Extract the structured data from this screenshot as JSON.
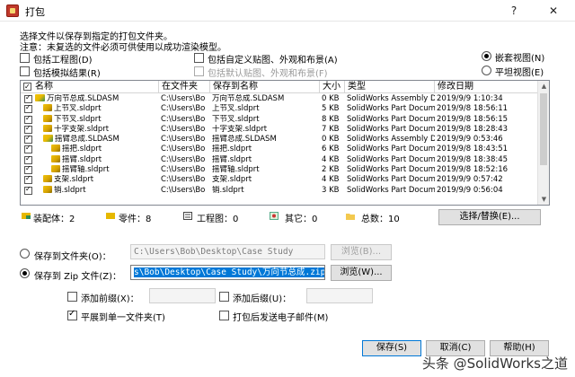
{
  "window": {
    "title": "打包",
    "help_glyph": "?",
    "close_glyph": "✕"
  },
  "hints": {
    "line1": "选择文件以保存到指定的打包文件夹。",
    "line2": "注意：未复选的文件必须可供使用以成功渲染模型。"
  },
  "options": {
    "include_drawings": "包括工程图(D)",
    "include_sim": "包括模拟结果(R)",
    "include_custom": "包括自定义贴图、外观和布景(A)",
    "include_default": "包括默认贴图、外观和布景(F)",
    "view_nested": "嵌套视图(N)",
    "view_flat": "平坦视图(E)"
  },
  "table": {
    "headers": [
      "名称",
      "在文件夹",
      "保存到名称",
      "大小",
      "类型",
      "修改日期"
    ],
    "rows": [
      {
        "name": "万向节总成.SLDASM",
        "folder": "C:\\Users\\Bo",
        "save_name": "万向节总成.SLDASM",
        "size": "0 KB",
        "type": "SolidWorks Assembly D",
        "date": "2019/9/9 1:10:34",
        "kind": "asm",
        "indent": 0
      },
      {
        "name": "上节叉.sldprt",
        "folder": "C:\\Users\\Bo",
        "save_name": "上节叉.sldprt",
        "size": "5 KB",
        "type": "SolidWorks Part Docum",
        "date": "2019/9/8 18:56:11",
        "kind": "part",
        "indent": 1
      },
      {
        "name": "下节叉.sldprt",
        "folder": "C:\\Users\\Bo",
        "save_name": "下节叉.sldprt",
        "size": "8 KB",
        "type": "SolidWorks Part Docum",
        "date": "2019/9/8 18:56:15",
        "kind": "part",
        "indent": 1
      },
      {
        "name": "十字支架.sldprt",
        "folder": "C:\\Users\\Bo",
        "save_name": "十字支架.sldprt",
        "size": "7 KB",
        "type": "SolidWorks Part Docum",
        "date": "2019/9/8 18:28:43",
        "kind": "part",
        "indent": 1
      },
      {
        "name": "摇臂总成.SLDASM",
        "folder": "C:\\Users\\Bo",
        "save_name": "摇臂总成.SLDASM",
        "size": "0 KB",
        "type": "SolidWorks Assembly D",
        "date": "2019/9/9 0:53:46",
        "kind": "asm",
        "indent": 1
      },
      {
        "name": "摇把.sldprt",
        "folder": "C:\\Users\\Bo",
        "save_name": "摇把.sldprt",
        "size": "6 KB",
        "type": "SolidWorks Part Docum",
        "date": "2019/9/8 18:43:51",
        "kind": "part",
        "indent": 2
      },
      {
        "name": "摇臂.sldprt",
        "folder": "C:\\Users\\Bo",
        "save_name": "摇臂.sldprt",
        "size": "4 KB",
        "type": "SolidWorks Part Docum",
        "date": "2019/9/8 18:38:45",
        "kind": "part",
        "indent": 2
      },
      {
        "name": "摇臂轴.sldprt",
        "folder": "C:\\Users\\Bo",
        "save_name": "摇臂轴.sldprt",
        "size": "2 KB",
        "type": "SolidWorks Part Docum",
        "date": "2019/9/8 18:52:16",
        "kind": "part",
        "indent": 2
      },
      {
        "name": "支架.sldprt",
        "folder": "C:\\Users\\Bo",
        "save_name": "支架.sldprt",
        "size": "4 KB",
        "type": "SolidWorks Part Docum",
        "date": "2019/9/9 0:57:42",
        "kind": "part",
        "indent": 1
      },
      {
        "name": "销.sldprt",
        "folder": "C:\\Users\\Bo",
        "save_name": "销.sldprt",
        "size": "3 KB",
        "type": "SolidWorks Part Docum",
        "date": "2019/9/9 0:56:04",
        "kind": "part",
        "indent": 1
      }
    ]
  },
  "summary": {
    "assemblies": "装配体：2",
    "parts": "零件：8",
    "drawings": "工程图：0",
    "others": "其它：0",
    "total": "总数：10",
    "replace_button": "选择/替换(E)..."
  },
  "save": {
    "to_folder_label": "保存到文件夹(O)：",
    "folder_path": "C:\\Users\\Bob\\Desktop\\Case Study",
    "to_zip_label": "保存到 Zip 文件(Z)：",
    "zip_path": "s\\Bob\\Desktop\\Case Study\\万向节总成.zip",
    "browse1": "浏览(B)...",
    "browse2": "浏览(W)...",
    "add_prefix": "添加前缀(X)：",
    "add_suffix": "添加后缀(U)：",
    "flatten": "平展到单一文件夹(T)",
    "email": "打包后发送电子邮件(M)"
  },
  "footer": {
    "save": "保存(S)",
    "cancel": "取消(C)",
    "help": "帮助(H)",
    "watermark": "头条 @SolidWorks之道"
  }
}
